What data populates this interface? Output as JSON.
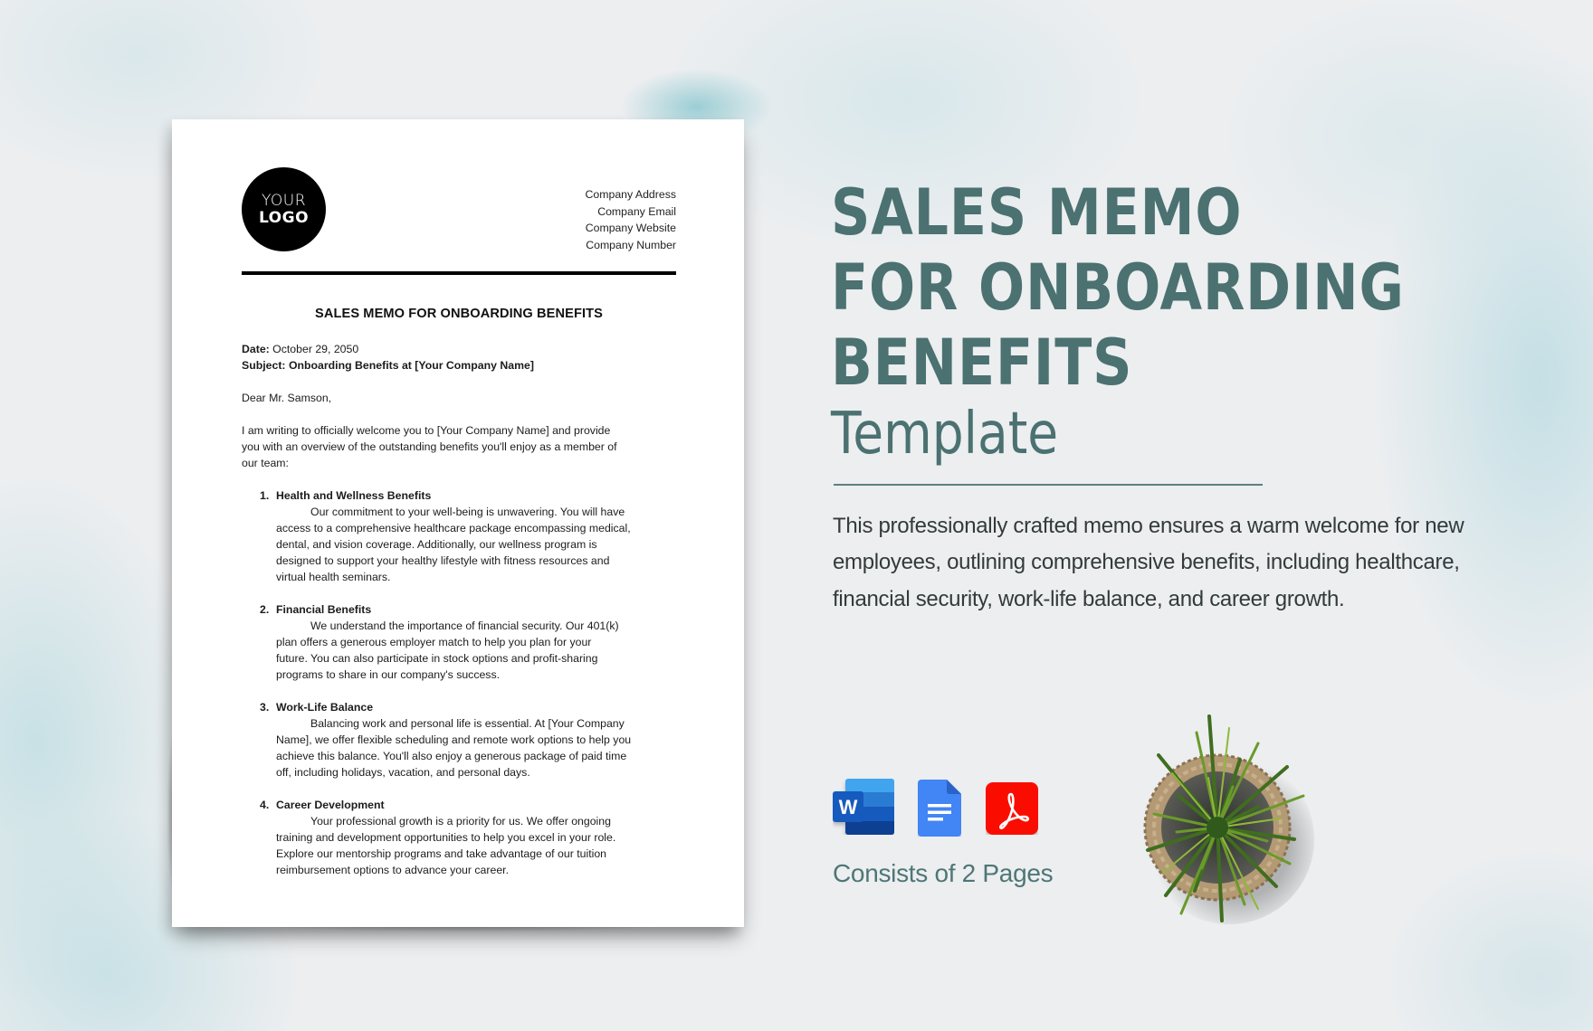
{
  "document": {
    "logo": {
      "line1": "YOUR",
      "line2": "LOGO"
    },
    "company_info": [
      "Company Address",
      "Company Email",
      "Company Website",
      "Company Number"
    ],
    "title": "SALES MEMO FOR ONBOARDING BENEFITS",
    "date_label": "Date:",
    "date_value": "October 29, 2050",
    "subject_label": "Subject:",
    "subject_value": "Onboarding Benefits at [Your Company Name]",
    "salutation": "Dear Mr. Samson,",
    "intro": "I am writing to officially welcome you to [Your Company Name] and provide you with an overview of the outstanding benefits you'll enjoy as a member of our team:",
    "items": [
      {
        "number": "1.",
        "heading": "Health and Wellness Benefits",
        "text": "Our commitment to your well-being is unwavering. You will have access to a comprehensive healthcare package encompassing medical, dental, and vision coverage. Additionally, our wellness program is designed to support your healthy lifestyle with fitness resources and virtual health seminars."
      },
      {
        "number": "2.",
        "heading": "Financial Benefits",
        "text": "We understand the importance of financial security. Our 401(k) plan offers a generous employer match to help you plan for your future. You can also participate in stock options and profit-sharing programs to share in our company's success."
      },
      {
        "number": "3.",
        "heading": "Work-Life Balance",
        "text": "Balancing work and personal life is essential. At [Your Company Name], we offer flexible scheduling and remote work options to help you achieve this balance. You'll also enjoy a generous package of paid time off, including holidays, vacation, and personal days."
      },
      {
        "number": "4.",
        "heading": "Career Development",
        "text": "Your professional growth is a priority for us. We offer ongoing training and development opportunities to help you excel in your role. Explore our mentorship programs and take advantage of our tuition reimbursement options to advance your career."
      }
    ]
  },
  "hero": {
    "title_lines": [
      "SALES MEMO",
      "FOR ONBOARDING",
      "BENEFITS"
    ],
    "subtitle": "Template",
    "description": "This professionally crafted memo ensures a warm welcome for new employees, outlining comprehensive benefits, including healthcare, financial security, work-life balance, and career growth."
  },
  "formats": [
    {
      "name": "Microsoft Word",
      "icon": "word-icon",
      "glyph": "W"
    },
    {
      "name": "Google Docs",
      "icon": "google-docs-icon"
    },
    {
      "name": "Adobe PDF",
      "icon": "pdf-icon"
    }
  ],
  "pages_label": "Consists of 2 Pages",
  "colors": {
    "heading": "#4b7171",
    "background": "#eceef0",
    "word_blue": "#185abd",
    "docs_blue": "#4285f4",
    "pdf_red": "#fa0f00"
  }
}
